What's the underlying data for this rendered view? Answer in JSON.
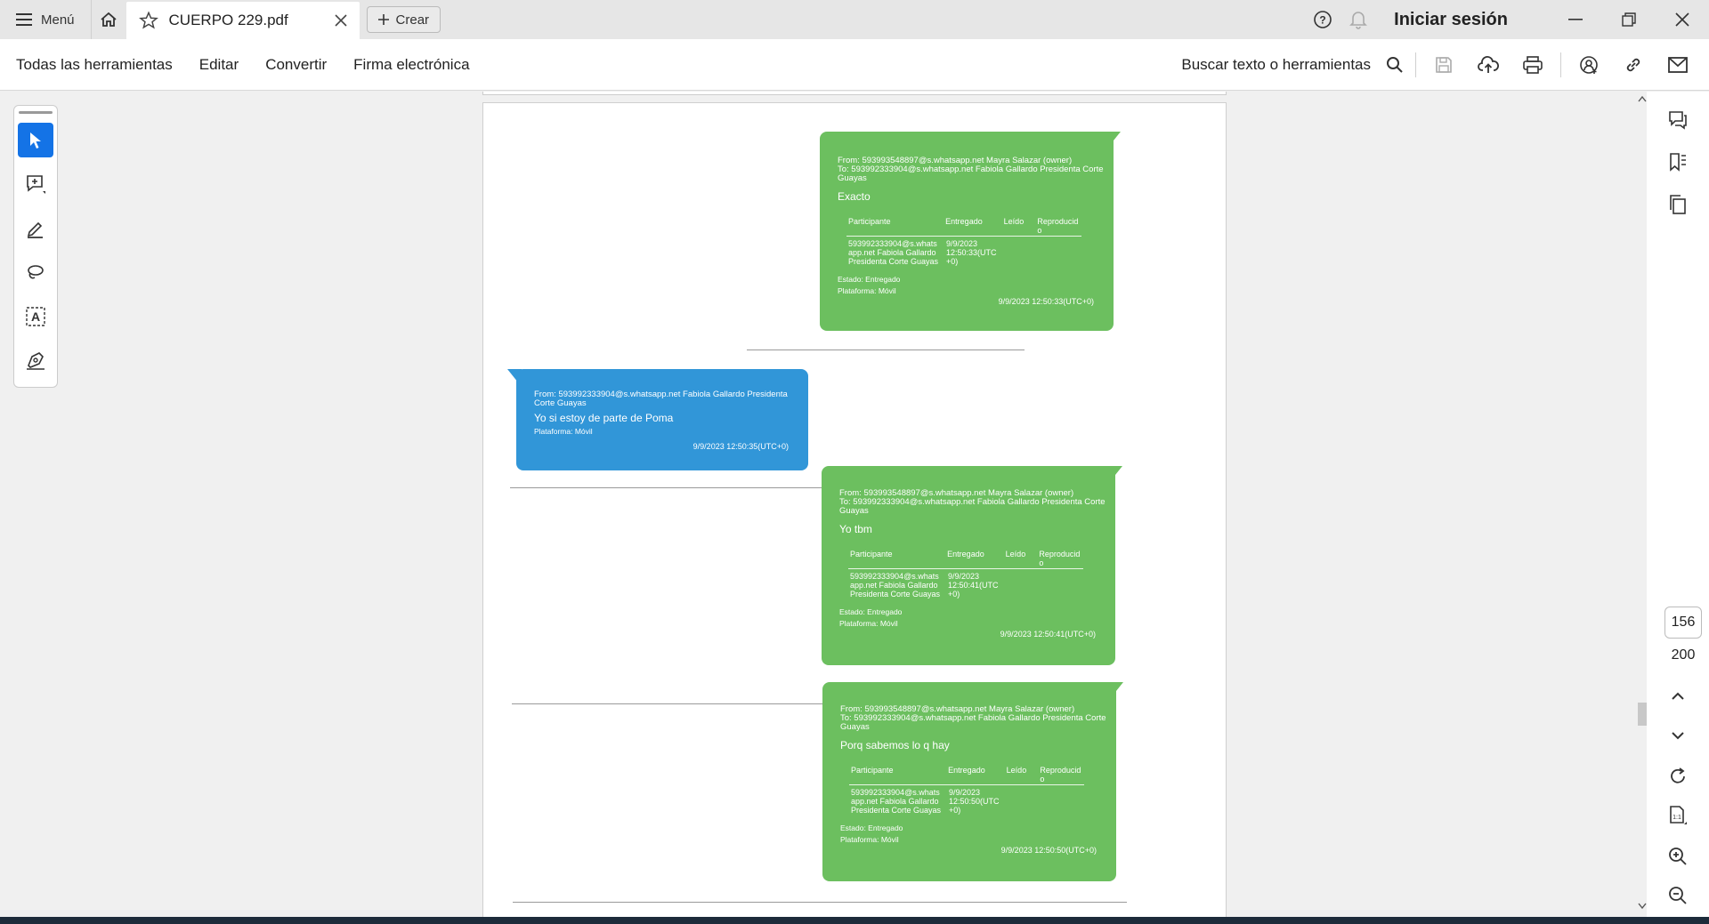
{
  "titlebar": {
    "menu_label": "Menú",
    "tab_title": "CUERPO 229.pdf",
    "create_label": "Crear",
    "signin_label": "Iniciar sesión"
  },
  "toolbar": {
    "items": [
      "Todas las herramientas",
      "Editar",
      "Convertir",
      "Firma electrónica"
    ],
    "search_label": "Buscar texto o herramientas"
  },
  "messages": [
    {
      "color": "#6cbf5f",
      "from": "From: 593993548897@s.whatsapp.net Mayra Salazar (owner)",
      "to": "To: 593992333904@s.whatsapp.net Fabiola Gallardo Presidenta Corte",
      "to2": "Guayas",
      "text": "Exacto",
      "cols": [
        "Participante",
        "Entregado",
        "Leído",
        "Reproducid",
        "o"
      ],
      "participant": [
        "593992333904@s.whats",
        "app.net Fabiola Gallardo",
        "Presidenta Corte Guayas"
      ],
      "delivered": [
        "9/9/2023",
        "12:50:33(UTC",
        "+0)"
      ],
      "estado": "Estado: Entregado",
      "plataforma": "Plataforma: Móvil",
      "timestamp": "9/9/2023 12:50:33(UTC+0)"
    },
    {
      "color": "#3196d8",
      "from": "From: 593992333904@s.whatsapp.net Fabiola Gallardo Presidenta",
      "from2": "Corte Guayas",
      "text": "Yo si estoy de parte de Poma",
      "plataforma": "Plataforma: Móvil",
      "timestamp": "9/9/2023 12:50:35(UTC+0)"
    },
    {
      "color": "#6cbf5f",
      "from": "From: 593993548897@s.whatsapp.net Mayra Salazar (owner)",
      "to": "To: 593992333904@s.whatsapp.net Fabiola Gallardo Presidenta Corte",
      "to2": "Guayas",
      "text": "Yo tbm",
      "cols": [
        "Participante",
        "Entregado",
        "Leído",
        "Reproducid",
        "o"
      ],
      "participant": [
        "593992333904@s.whats",
        "app.net Fabiola Gallardo",
        "Presidenta Corte Guayas"
      ],
      "delivered": [
        "9/9/2023",
        "12:50:41(UTC",
        "+0)"
      ],
      "estado": "Estado: Entregado",
      "plataforma": "Plataforma: Móvil",
      "timestamp": "9/9/2023 12:50:41(UTC+0)"
    },
    {
      "color": "#6cbf5f",
      "from": "From: 593993548897@s.whatsapp.net Mayra Salazar (owner)",
      "to": "To: 593992333904@s.whatsapp.net Fabiola Gallardo Presidenta Corte",
      "to2": "Guayas",
      "text": "Porq sabemos lo q hay",
      "cols": [
        "Participante",
        "Entregado",
        "Leído",
        "Reproducid",
        "o"
      ],
      "participant": [
        "593992333904@s.whats",
        "app.net Fabiola Gallardo",
        "Presidenta Corte Guayas"
      ],
      "delivered": [
        "9/9/2023",
        "12:50:50(UTC",
        "+0)"
      ],
      "estado": "Estado: Entregado",
      "plataforma": "Plataforma: Móvil",
      "timestamp": "9/9/2023 12:50:50(UTC+0)"
    }
  ],
  "pager": {
    "current": "156",
    "total": "200"
  }
}
